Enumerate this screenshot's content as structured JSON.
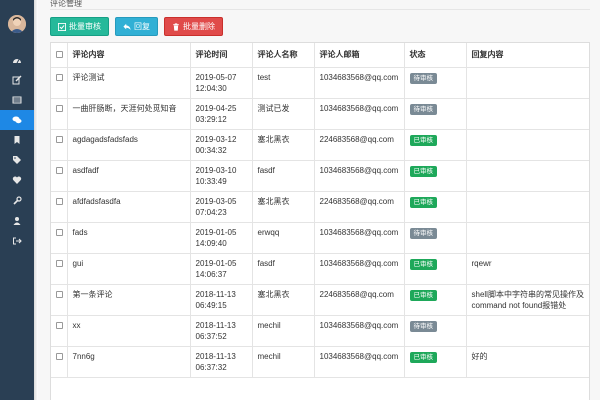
{
  "breadcrumb": "评论管理",
  "toolbar": {
    "batch_approve": "批量审核",
    "reply": "回复",
    "batch_delete": "批量删除"
  },
  "colors": {
    "sidebar": "#2a3f54",
    "active": "#1e88e5",
    "approve": "#26b99a",
    "reply": "#31b0d5",
    "delete": "#e04b4a",
    "pending": "#7a8a95",
    "approved": "#1ea85a"
  },
  "sidebar": {
    "items": [
      {
        "icon": "dashboard-icon"
      },
      {
        "icon": "edit-icon"
      },
      {
        "icon": "table-icon"
      },
      {
        "icon": "comments-icon",
        "active": true
      },
      {
        "icon": "bookmark-icon"
      },
      {
        "icon": "tags-icon"
      },
      {
        "icon": "heart-icon"
      },
      {
        "icon": "wrench-icon"
      },
      {
        "icon": "users-icon"
      },
      {
        "icon": "sign-out-icon"
      }
    ]
  },
  "table": {
    "headers": [
      "评论内容",
      "评论时间",
      "评论人名称",
      "评论人邮箱",
      "状态",
      "回复内容"
    ],
    "rows": [
      {
        "content": "评论测试",
        "date": "2019-05-07",
        "time": "12:04:30",
        "name": "test",
        "email": "1034683568@qq.com",
        "status": "待审核",
        "status_type": "pending",
        "reply": ""
      },
      {
        "content": "一曲肝肠断，天涯何处觅知音",
        "date": "2019-04-25",
        "time": "03:29:12",
        "name": "测试已发",
        "email": "1034683568@qq.com",
        "status": "待审核",
        "status_type": "pending",
        "reply": ""
      },
      {
        "content": "agdagadsfadsfads",
        "date": "2019-03-12",
        "time": "00:34:32",
        "name": "塞北黑衣",
        "email": "224683568@qq.com",
        "status": "已审核",
        "status_type": "approved",
        "reply": ""
      },
      {
        "content": "asdfadf",
        "date": "2019-03-10",
        "time": "10:33:49",
        "name": "fasdf",
        "email": "1034683568@qq.com",
        "status": "已审核",
        "status_type": "approved",
        "reply": ""
      },
      {
        "content": "afdfadsfasdfa",
        "date": "2019-03-05",
        "time": "07:04:23",
        "name": "塞北黑衣",
        "email": "224683568@qq.com",
        "status": "已审核",
        "status_type": "approved",
        "reply": ""
      },
      {
        "content": "fads",
        "date": "2019-01-05",
        "time": "14:09:40",
        "name": "erwqq",
        "email": "1034683568@qq.com",
        "status": "待审核",
        "status_type": "pending",
        "reply": ""
      },
      {
        "content": "gui",
        "date": "2019-01-05",
        "time": "14:06:37",
        "name": "fasdf",
        "email": "1034683568@qq.com",
        "status": "已审核",
        "status_type": "approved",
        "reply": "rqewr"
      },
      {
        "content": "第一条评论",
        "date": "2018-11-13",
        "time": "06:49:15",
        "name": "塞北黑衣",
        "email": "224683568@qq.com",
        "status": "已审核",
        "status_type": "approved",
        "reply": "shell脚本中字符串的常见操作及command not found报错处"
      },
      {
        "content": "xx",
        "date": "2018-11-13",
        "time": "06:37:52",
        "name": "mechil",
        "email": "1034683568@qq.com",
        "status": "待审核",
        "status_type": "pending",
        "reply": ""
      },
      {
        "content": "7nn6g",
        "date": "2018-11-13",
        "time": "06:37:32",
        "name": "mechil",
        "email": "1034683568@qq.com",
        "status": "已审核",
        "status_type": "approved",
        "reply": "好的"
      }
    ]
  }
}
